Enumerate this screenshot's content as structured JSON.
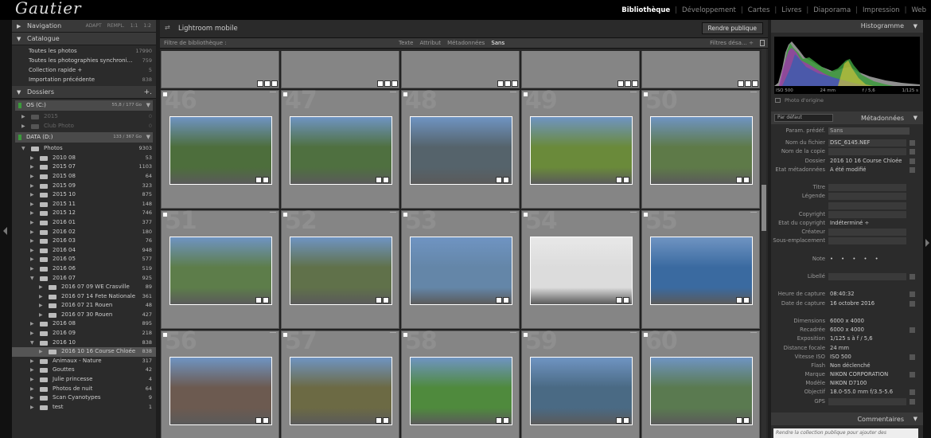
{
  "app": {
    "brand": "Gautier"
  },
  "modules": [
    "Bibliothèque",
    "Développement",
    "Cartes",
    "Livres",
    "Diaporama",
    "Impression",
    "Web"
  ],
  "active_module": "Bibliothèque",
  "navigator": {
    "title": "Navigation",
    "zoom": [
      "ADAPT",
      "REMPL.",
      "1:1",
      "1:2"
    ]
  },
  "catalog": {
    "title": "Catalogue",
    "items": [
      {
        "label": "Toutes les photos",
        "count": "17990"
      },
      {
        "label": "Toutes les photographies synchroni…",
        "count": "759"
      },
      {
        "label": "Collection rapide +",
        "count": "5"
      },
      {
        "label": "Importation précédente",
        "count": "838"
      }
    ]
  },
  "folders": {
    "title": "Dossiers",
    "add": "+.",
    "volume1": {
      "name": "OS (C:)",
      "info": "55,8 / 177 Go"
    },
    "volume1_items": [
      {
        "label": "2015",
        "count": "0"
      },
      {
        "label": "Club Photo",
        "count": "0"
      }
    ],
    "volume2": {
      "name": "DATA (D:)",
      "info": "133 / 367 Go"
    },
    "tree": [
      {
        "label": "Photos",
        "count": "9303",
        "level": 0,
        "open": true
      },
      {
        "label": "2010 08",
        "count": "53",
        "level": 1
      },
      {
        "label": "2015 07",
        "count": "1103",
        "level": 1
      },
      {
        "label": "2015 08",
        "count": "64",
        "level": 1
      },
      {
        "label": "2015 09",
        "count": "323",
        "level": 1
      },
      {
        "label": "2015 10",
        "count": "875",
        "level": 1
      },
      {
        "label": "2015 11",
        "count": "148",
        "level": 1
      },
      {
        "label": "2015 12",
        "count": "746",
        "level": 1
      },
      {
        "label": "2016 01",
        "count": "377",
        "level": 1
      },
      {
        "label": "2016 02",
        "count": "180",
        "level": 1
      },
      {
        "label": "2016 03",
        "count": "76",
        "level": 1
      },
      {
        "label": "2016 04",
        "count": "948",
        "level": 1
      },
      {
        "label": "2016 05",
        "count": "577",
        "level": 1
      },
      {
        "label": "2016 06",
        "count": "519",
        "level": 1
      },
      {
        "label": "2016 07",
        "count": "925",
        "level": 1,
        "open": true
      },
      {
        "label": "2016 07 09 WE Crasville",
        "count": "89",
        "level": 2
      },
      {
        "label": "2016 07 14 Fete Nationale",
        "count": "361",
        "level": 2
      },
      {
        "label": "2016 07 21 Rouen",
        "count": "48",
        "level": 2
      },
      {
        "label": "2016 07 30 Rouen",
        "count": "427",
        "level": 2
      },
      {
        "label": "2016 08",
        "count": "895",
        "level": 1
      },
      {
        "label": "2016 09",
        "count": "218",
        "level": 1
      },
      {
        "label": "2016 10",
        "count": "838",
        "level": 1,
        "open": true
      },
      {
        "label": "2016 10 16 Course Chloée",
        "count": "838",
        "level": 2,
        "selected": true
      },
      {
        "label": "Animaux - Nature",
        "count": "317",
        "level": 1
      },
      {
        "label": "Gouttes",
        "count": "42",
        "level": 1
      },
      {
        "label": "Julie princesse",
        "count": "4",
        "level": 1
      },
      {
        "label": "Photos de nuit",
        "count": "64",
        "level": 1
      },
      {
        "label": "Scan Cyanotypes",
        "count": "9",
        "level": 1
      },
      {
        "label": "test",
        "count": "1",
        "level": 1
      }
    ]
  },
  "center": {
    "title": "Lightroom mobile",
    "publish_button": "Rendre publique",
    "filter_label": "Filtre de bibliothèque :",
    "filter_tabs": [
      "Texte",
      "Attribut",
      "Métadonnées",
      "Sans"
    ],
    "active_filter": "Sans",
    "filter_right": "Filtres désa… ÷",
    "rows": [
      [
        "46",
        "47",
        "48",
        "49",
        "50"
      ],
      [
        "51",
        "52",
        "53",
        "54",
        "55"
      ],
      [
        "56",
        "57",
        "58",
        "59",
        "60"
      ]
    ],
    "photo_colors": [
      [
        "#4d6e3c",
        "#4f7040",
        "#55636b",
        "#6a8a3a",
        "#5e7a48"
      ],
      [
        "#5d7d4a",
        "#60714a",
        "#6486a8",
        "#dcdcdc",
        "#3a6aa0"
      ],
      [
        "#6c5a50",
        "#6c6a44",
        "#4f8a3d",
        "#4a6a84",
        "#5a7a50"
      ]
    ]
  },
  "histogram": {
    "title": "Histogramme",
    "iso": "ISO 500",
    "focal": "24 mm",
    "aperture": "f / 5,6",
    "shutter": "1/125 s",
    "original": "Photo d'origine"
  },
  "metadata": {
    "title": "Métadonnées",
    "preset_select": "Par défaut",
    "preset_label": "Param. prédéf.",
    "preset_value": "Sans",
    "fields": [
      {
        "k": "Nom du fichier",
        "v": "DSC_6145.NEF",
        "box": true,
        "ib": true
      },
      {
        "k": "Nom de la copie",
        "v": "",
        "box": true,
        "ib": true
      },
      {
        "k": "Dossier",
        "v": "2016 10 16 Course Chloée",
        "ib": true
      },
      {
        "k": "Etat métadonnées",
        "v": "A été modifié",
        "ib": true
      },
      {
        "k": "",
        "v": ""
      },
      {
        "k": "Titre",
        "v": "",
        "box": true
      },
      {
        "k": "Légende",
        "v": "",
        "box": true
      },
      {
        "k": "",
        "v": "",
        "box": true
      },
      {
        "k": "Copyright",
        "v": "",
        "box": true
      },
      {
        "k": "Etat du copyright",
        "v": "Indéterminé ÷"
      },
      {
        "k": "Créateur",
        "v": "",
        "box": true
      },
      {
        "k": "Sous-emplacement",
        "v": "",
        "box": true
      },
      {
        "k": "",
        "v": ""
      },
      {
        "k": "Note",
        "v": "• • • • •",
        "stars": true
      },
      {
        "k": "",
        "v": ""
      },
      {
        "k": "Libellé",
        "v": "",
        "box": true,
        "ib": true
      },
      {
        "k": "",
        "v": ""
      },
      {
        "k": "Heure de capture",
        "v": "08:40:32",
        "ib": true
      },
      {
        "k": "Date de capture",
        "v": "16 octobre 2016",
        "ib": true
      },
      {
        "k": "",
        "v": ""
      },
      {
        "k": "Dimensions",
        "v": "6000 x 4000"
      },
      {
        "k": "Recadrée",
        "v": "6000 x 4000",
        "ib": true
      },
      {
        "k": "Exposition",
        "v": "1/125 s à f / 5,6"
      },
      {
        "k": "Distance focale",
        "v": "24 mm"
      },
      {
        "k": "Vitesse ISO",
        "v": "ISO 500",
        "ib": true
      },
      {
        "k": "Flash",
        "v": "Non déclenché"
      },
      {
        "k": "Marque",
        "v": "NIKON CORPORATION",
        "ib": true
      },
      {
        "k": "Modèle",
        "v": "NIKON D7100"
      },
      {
        "k": "Objectif",
        "v": "18.0-55.0 mm f/3.5-5.6",
        "ib": true
      },
      {
        "k": "GPS",
        "v": "",
        "box": true,
        "ib": true
      }
    ]
  },
  "comments": {
    "title": "Commentaires",
    "placeholder": "Rendre la collection publique pour ajouter des"
  }
}
